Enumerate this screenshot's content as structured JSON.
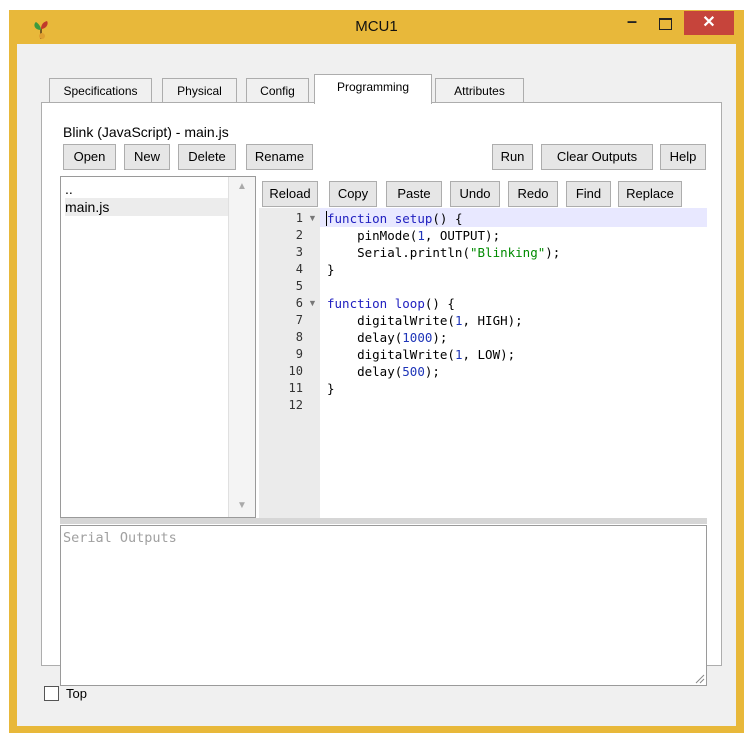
{
  "window": {
    "title": "MCU1",
    "minimize_glyph": "–",
    "close_glyph": "✕",
    "icons": {
      "app": "sprout-icon",
      "minimize": "minimize-icon",
      "maximize": "maximize-icon",
      "close": "close-icon"
    }
  },
  "tabs": [
    {
      "label": "Specifications",
      "active": false
    },
    {
      "label": "Physical",
      "active": false
    },
    {
      "label": "Config",
      "active": false
    },
    {
      "label": "Programming",
      "active": true
    },
    {
      "label": "Attributes",
      "active": false
    }
  ],
  "project": {
    "title": "Blink (JavaScript) - main.js",
    "file_buttons": [
      "Open",
      "New",
      "Delete",
      "Rename"
    ],
    "run_buttons": [
      "Run",
      "Clear Outputs",
      "Help"
    ]
  },
  "file_list": {
    "items": [
      "..",
      "main.js"
    ],
    "selected": "main.js"
  },
  "editor": {
    "toolbar": [
      "Reload",
      "Copy",
      "Paste",
      "Undo",
      "Redo",
      "Find",
      "Replace"
    ],
    "line_numbers": [
      "1",
      "2",
      "3",
      "4",
      "5",
      "6",
      "7",
      "8",
      "9",
      "10",
      "11",
      "12"
    ],
    "fold_markers_on_lines": [
      1,
      6
    ],
    "code": [
      "function setup() {",
      "    pinMode(1, OUTPUT);",
      "    Serial.println(\"Blinking\");",
      "}",
      "",
      "function loop() {",
      "    digitalWrite(1, HIGH);",
      "    delay(1000);",
      "    digitalWrite(1, LOW);",
      "    delay(500);",
      "}",
      ""
    ]
  },
  "serial": {
    "placeholder": "Serial Outputs"
  },
  "footer": {
    "top_label": "Top",
    "top_checked": false
  },
  "colors": {
    "title_bar": "#e8b83a",
    "close_button": "#c6443b",
    "keyword": "#2020c0",
    "number": "#1e35b8",
    "string": "#008a00",
    "active_line": "#e8e8ff"
  }
}
